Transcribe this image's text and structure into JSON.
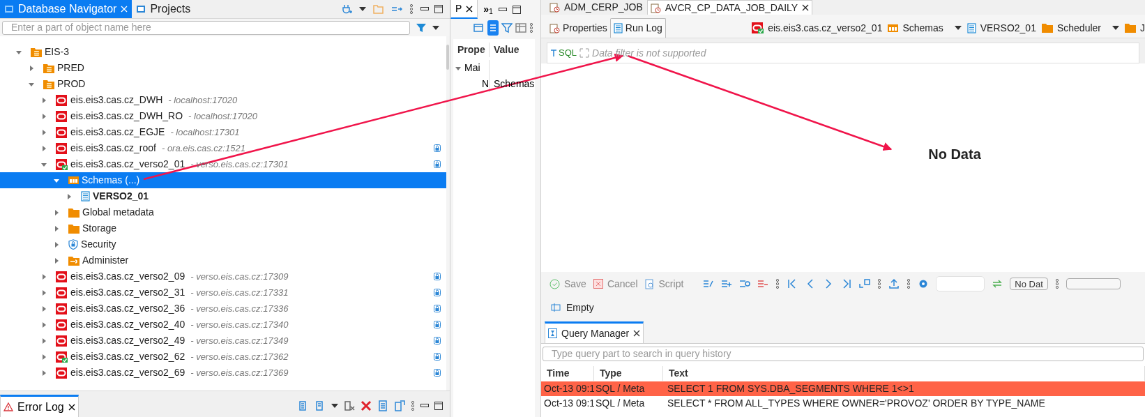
{
  "left_panel": {
    "tabs": [
      {
        "label": "Database Navigator",
        "selected": true,
        "closable": true
      },
      {
        "label": "Projects",
        "selected": false,
        "closable": false
      }
    ],
    "search": {
      "placeholder": "Enter a part of object name here"
    },
    "tree": [
      {
        "label": "EIS-3",
        "kind": "group",
        "expanded": true,
        "selected": false,
        "children": [
          {
            "label": "PRED",
            "kind": "group",
            "expanded": false,
            "selected": false
          },
          {
            "label": "PROD",
            "kind": "group",
            "expanded": true,
            "selected": false,
            "children": [
              {
                "label": "eis.eis3.cas.cz_DWH",
                "host": "- localhost:17020",
                "kind": "connection",
                "connected": false,
                "protected": false,
                "expanded": false,
                "selected": false
              },
              {
                "label": "eis.eis3.cas.cz_DWH_RO",
                "host": "- localhost:17020",
                "kind": "connection",
                "connected": false,
                "protected": false,
                "expanded": false,
                "selected": false
              },
              {
                "label": "eis.eis3.cas.cz_EGJE",
                "host": "- localhost:17301",
                "kind": "connection",
                "connected": false,
                "protected": false,
                "expanded": false,
                "selected": false
              },
              {
                "label": "eis.eis3.cas.cz_roof",
                "host": "- ora.eis.cas.cz:1521",
                "kind": "connection",
                "connected": false,
                "protected": true,
                "expanded": false,
                "selected": false
              },
              {
                "label": "eis.eis3.cas.cz_verso2_01",
                "host": "- verso.eis.cas.cz:17301",
                "kind": "connection",
                "connected": true,
                "protected": true,
                "expanded": true,
                "selected": false,
                "children": [
                  {
                    "label": "Schemas (...)",
                    "kind": "schemas",
                    "expanded": true,
                    "selected": true,
                    "children": [
                      {
                        "label": "VERSO2_01",
                        "kind": "schema",
                        "default": true,
                        "expanded": false,
                        "selected": false
                      }
                    ]
                  },
                  {
                    "label": "Global metadata",
                    "kind": "folder",
                    "expanded": false,
                    "selected": false
                  },
                  {
                    "label": "Storage",
                    "kind": "folder",
                    "expanded": false,
                    "selected": false
                  },
                  {
                    "label": "Security",
                    "kind": "security",
                    "expanded": false,
                    "selected": false
                  },
                  {
                    "label": "Administer",
                    "kind": "admin",
                    "expanded": false,
                    "selected": false
                  }
                ]
              },
              {
                "label": "eis.eis3.cas.cz_verso2_09",
                "host": "- verso.eis.cas.cz:17309",
                "kind": "connection",
                "connected": false,
                "protected": true,
                "expanded": false,
                "selected": false
              },
              {
                "label": "eis.eis3.cas.cz_verso2_31",
                "host": "- verso.eis.cas.cz:17331",
                "kind": "connection",
                "connected": false,
                "protected": true,
                "expanded": false,
                "selected": false
              },
              {
                "label": "eis.eis3.cas.cz_verso2_36",
                "host": "- verso.eis.cas.cz:17336",
                "kind": "connection",
                "connected": false,
                "protected": true,
                "expanded": false,
                "selected": false
              },
              {
                "label": "eis.eis3.cas.cz_verso2_40",
                "host": "- verso.eis.cas.cz:17340",
                "kind": "connection",
                "connected": false,
                "protected": true,
                "expanded": false,
                "selected": false
              },
              {
                "label": "eis.eis3.cas.cz_verso2_49",
                "host": "- verso.eis.cas.cz:17349",
                "kind": "connection",
                "connected": false,
                "protected": true,
                "expanded": false,
                "selected": false
              },
              {
                "label": "eis.eis3.cas.cz_verso2_62",
                "host": "- verso.eis.cas.cz:17362",
                "kind": "connection",
                "connected": true,
                "protected": true,
                "expanded": false,
                "selected": false
              },
              {
                "label": "eis.eis3.cas.cz_verso2_69",
                "host": "- verso.eis.cas.cz:17369",
                "kind": "connection",
                "connected": false,
                "protected": true,
                "expanded": false,
                "selected": false
              }
            ]
          }
        ]
      }
    ]
  },
  "bottom_panel": {
    "tabs": [
      {
        "label": "Error Log",
        "selected": true
      }
    ]
  },
  "properties_panel": {
    "tab": {
      "label": "P",
      "selected": true
    },
    "overflow": {
      "glyph": "»",
      "count": "1"
    },
    "columns": [
      "Prope",
      "Value"
    ],
    "rows": [
      {
        "name": "Mai",
        "expanded": true,
        "children": [
          {
            "name": "N",
            "value": "Schemas"
          }
        ]
      }
    ]
  },
  "editor": {
    "tabs": [
      {
        "label": "ADM_CERP_JOB",
        "selected": false
      },
      {
        "label": "AVCR_CP_DATA_JOB_DAILY",
        "selected": true
      }
    ],
    "sub_tabs": [
      {
        "label": "Properties",
        "selected": false
      },
      {
        "label": "Run Log",
        "selected": true
      }
    ],
    "breadcrumb": [
      {
        "label": "eis.eis3.cas.cz_verso2_01",
        "kind": "connection",
        "dropdown": false
      },
      {
        "label": "Schemas",
        "kind": "schemas",
        "dropdown": true
      },
      {
        "label": "VERSO2_01",
        "kind": "schema",
        "dropdown": false
      },
      {
        "label": "Scheduler",
        "kind": "folder",
        "dropdown": true
      },
      {
        "label": "J",
        "kind": "folder",
        "dropdown": false
      }
    ],
    "filter": {
      "sql_label": "SQL",
      "placeholder": "Data filter is not supported"
    },
    "empty_message": "No Data",
    "toolbar": {
      "actions": [
        {
          "label": "Save",
          "kind": "save"
        },
        {
          "label": "Cancel",
          "kind": "cancel"
        },
        {
          "label": "Script",
          "kind": "script"
        }
      ],
      "status_button": "No Dat"
    },
    "panel_toggle": "Empty"
  },
  "query_manager": {
    "tab": {
      "label": "Query Manager",
      "selected": true
    },
    "search": {
      "placeholder": "Type query part to search in query history"
    },
    "columns": [
      "Time",
      "Type",
      "Text"
    ],
    "rows": [
      {
        "time": "Oct-13 09:1",
        "type": "SQL / Meta",
        "text": "SELECT 1 FROM SYS.DBA_SEGMENTS WHERE 1<>1",
        "failed": true
      },
      {
        "time": "Oct-13 09:1",
        "type": "SQL / Meta",
        "text": "SELECT  * FROM ALL_TYPES WHERE OWNER='PROVOZ' ORDER BY TYPE_NAME",
        "failed": false
      }
    ]
  }
}
